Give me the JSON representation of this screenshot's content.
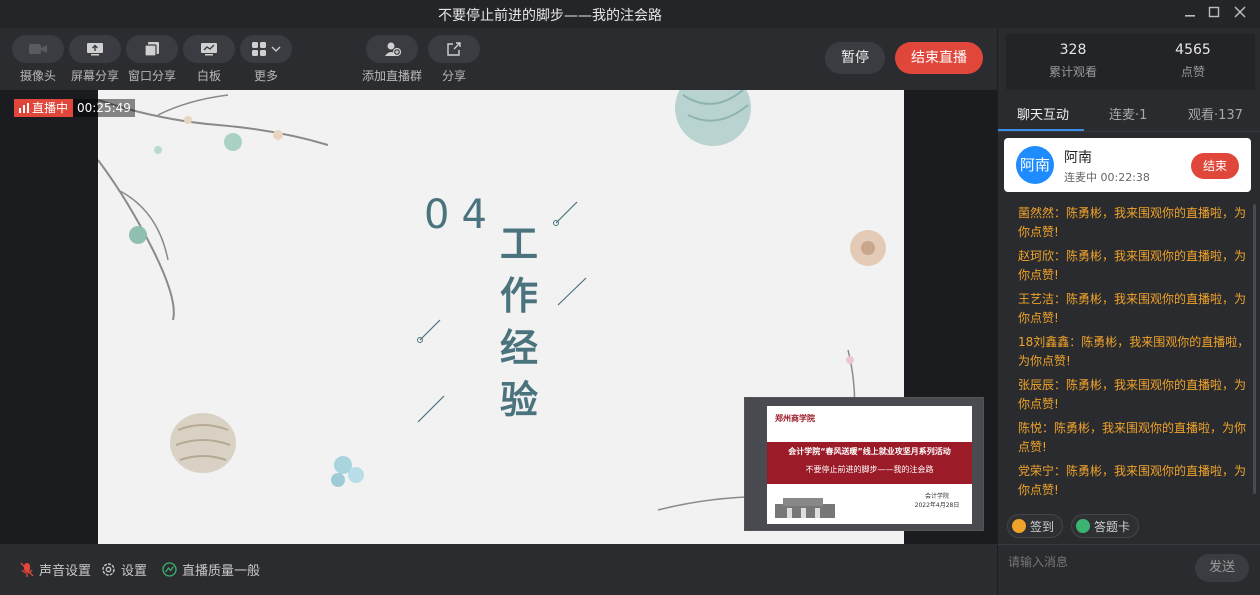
{
  "window": {
    "title": "不要停止前进的脚步——我的注会路"
  },
  "toolbar": {
    "tools": [
      {
        "label": "摄像头",
        "icon": "camera-icon"
      },
      {
        "label": "屏幕分享",
        "icon": "screen-share-icon"
      },
      {
        "label": "窗口分享",
        "icon": "window-share-icon"
      },
      {
        "label": "白板",
        "icon": "whiteboard-icon"
      },
      {
        "label": "更多",
        "icon": "grid-icon"
      },
      {
        "label": "添加直播群",
        "icon": "add-group-icon"
      },
      {
        "label": "分享",
        "icon": "share-icon"
      }
    ],
    "pause_label": "暂停",
    "end_label": "结束直播"
  },
  "live": {
    "status": "直播中",
    "elapsed": "00:25:49"
  },
  "slide": {
    "number": "04",
    "title_chars": [
      "工",
      "作",
      "经",
      "验"
    ]
  },
  "pip": {
    "school": "郑州商学院",
    "line1": "会计学院“春风送暖”线上就业攻坚月系列活动",
    "line2": "不要停止前进的脚步——我的注会路",
    "footer1": "会计学院",
    "footer2": "2022年4月28日"
  },
  "bottom": {
    "audio": "声音设置",
    "settings": "设置",
    "quality": "直播质量一般"
  },
  "stats": {
    "total_views": "328",
    "total_views_label": "累计观看",
    "likes": "4565",
    "likes_label": "点赞"
  },
  "tabs": [
    "聊天互动",
    "连麦·1",
    "观看·137"
  ],
  "co_host": {
    "avatar": "阿南",
    "name": "阿南",
    "status": "连麦中 00:22:38",
    "end_label": "结束"
  },
  "messages": [
    "菌然然：陈勇彬，我来围观你的直播啦，为你点赞!",
    "赵珂欣：陈勇彬，我来围观你的直播啦，为你点赞!",
    "王艺洁：陈勇彬，我来围观你的直播啦，为你点赞!",
    "18刘鑫鑫：陈勇彬，我来围观你的直播啦，为你点赞!",
    "张辰辰：陈勇彬，我来围观你的直播啦，为你点赞!",
    "陈悦：陈勇彬，我来围观你的直播啦，为你点赞!",
    "党荣宁：陈勇彬，我来围观你的直播啦，为你点赞!"
  ],
  "quick": {
    "checkin": "签到",
    "quiz": "答题卡"
  },
  "input": {
    "placeholder": "请输入消息",
    "send_label": "发送"
  },
  "colors": {
    "accent_red": "#e0473a",
    "accent_blue": "#1e8bff",
    "message_orange": "#f0a32a",
    "slide_teal": "#4a737d"
  }
}
